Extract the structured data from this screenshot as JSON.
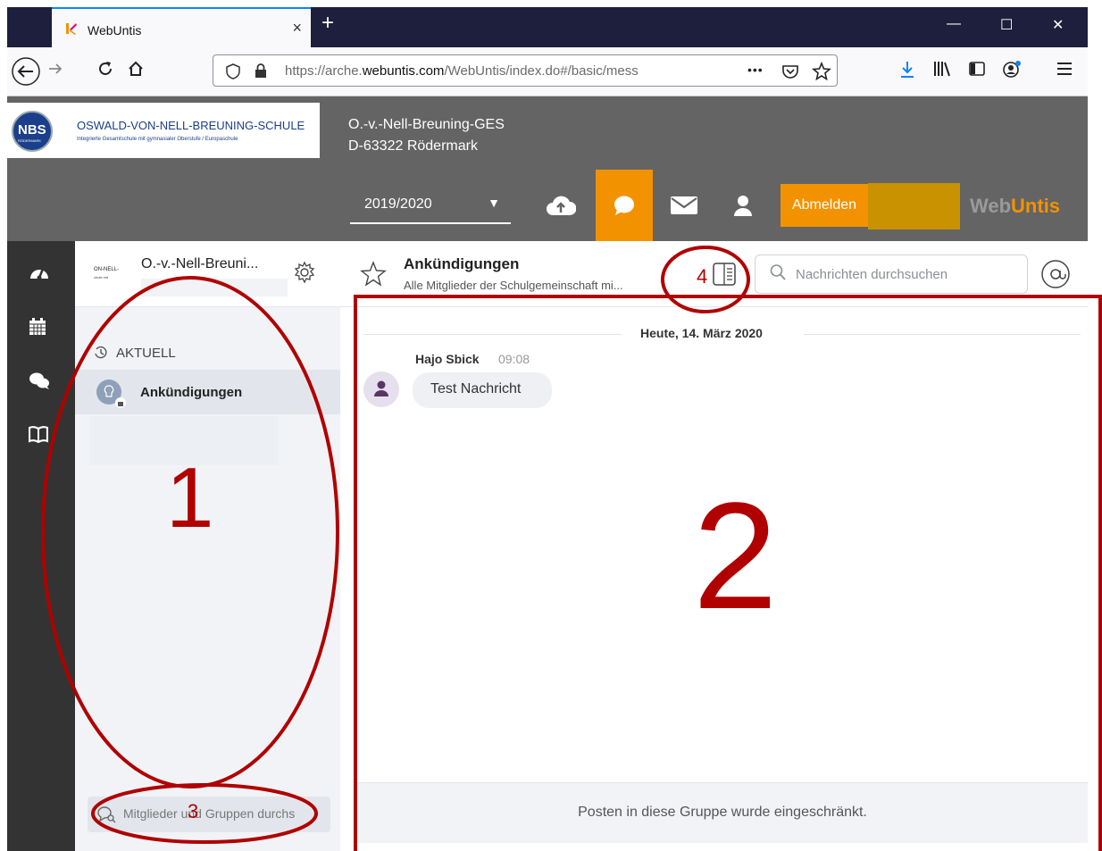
{
  "browser": {
    "tab_title": "WebUntis",
    "tab_close": "×",
    "new_tab": "+",
    "url": "https://arche.webuntis.com/WebUntis/index.do#/basic/mess",
    "url_prefix": "https://arche.",
    "url_domain": "webuntis.com",
    "url_path": "/WebUntis/index.do#/basic/mess",
    "more": "•••",
    "window_controls": [
      "—",
      "☐",
      "✕"
    ]
  },
  "header": {
    "logo_badge": "NBS",
    "logo_badge_sub": "RÖDERMARK",
    "logo_title": "OSWALD-VON-NELL-BREUNING-SCHULE",
    "logo_subtitle": "Integrierte Gesamtschule mit gymnasialer Oberstufe / Europaschule",
    "school_line1": "O.-v.-Nell-Breuning-GES",
    "school_line2": "D-63322 Rödermark",
    "year": "2019/2020",
    "logout": "Abmelden",
    "brand_web": "Web",
    "brand_untis": "Untis"
  },
  "side": {
    "school_short": "O.-v.-Nell-Breuni...",
    "logo_small_1": "ON-NELL-",
    "logo_small_2": "chule mit",
    "section": "AKTUELL",
    "group": "Ankündigungen",
    "search_placeholder": "Mitglieder und Gruppen durchs"
  },
  "conversation": {
    "title": "Ankündigungen",
    "subtitle": "Alle Mitglieder der Schulgemeinschaft mi...",
    "search_placeholder": "Nachrichten durchsuchen",
    "date": "Heute, 14. März 2020",
    "sender": "Hajo Sbick",
    "time": "09:08",
    "message": "Test Nachricht",
    "restricted": "Posten in diese Gruppe wurde eingeschränkt."
  },
  "annotations": {
    "n1": "1",
    "n2": "2",
    "n3": "3",
    "n4": "4"
  },
  "colors": {
    "accent": "#f39200",
    "annotation": "#b00000",
    "header": "#646464"
  }
}
